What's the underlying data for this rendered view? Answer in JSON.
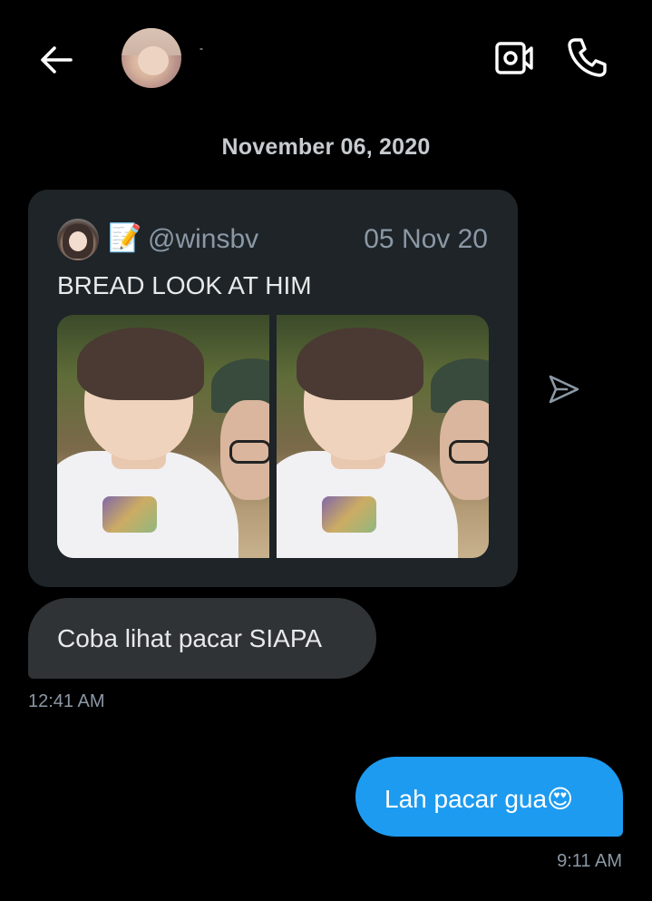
{
  "header": {
    "contact_name": "-",
    "back_icon": "back-arrow-icon",
    "video_call_icon": "video-camera-icon",
    "voice_call_icon": "phone-icon"
  },
  "conversation": {
    "date_separator": "November 06, 2020",
    "shared_tweet": {
      "emoji": "📝",
      "handle": "@winsbv",
      "date": "05 Nov 20",
      "text": "BREAD LOOK AT HIM",
      "share_icon": "send-icon"
    },
    "messages": [
      {
        "direction": "incoming",
        "text": "Coba lihat pacar SIAPA",
        "time": "12:41 AM"
      },
      {
        "direction": "outgoing",
        "text": "Lah pacar gua😍",
        "time": "9:11 AM"
      }
    ]
  },
  "colors": {
    "background": "#000000",
    "outgoing_bubble": "#1d9bf0",
    "incoming_bubble": "#2f3336",
    "card": "#1e2428",
    "muted_text": "#8b98a5"
  }
}
